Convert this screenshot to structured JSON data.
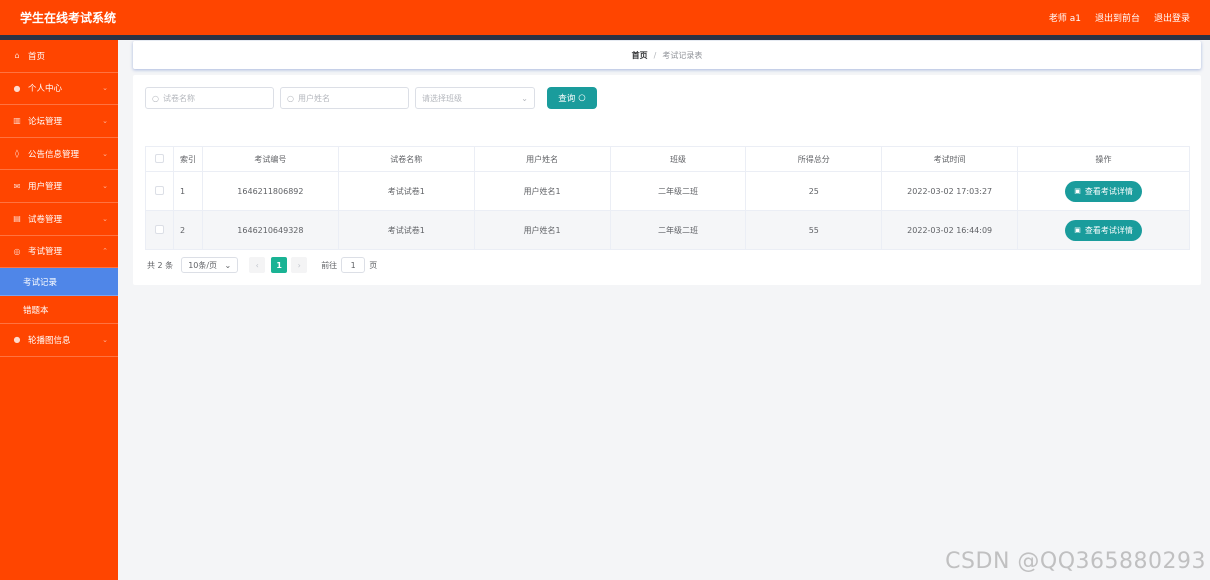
{
  "header": {
    "title": "学生在线考试系统",
    "user": "老师 a1",
    "to_front": "退出到前台",
    "logout": "退出登录"
  },
  "sidebar": {
    "items": [
      {
        "label": "首页",
        "icon": "home-icon",
        "has_children": false
      },
      {
        "label": "个人中心",
        "icon": "user-icon",
        "has_children": true
      },
      {
        "label": "论坛管理",
        "icon": "forum-icon",
        "has_children": true
      },
      {
        "label": "公告信息管理",
        "icon": "notice-icon",
        "has_children": true
      },
      {
        "label": "用户管理",
        "icon": "mail-icon",
        "has_children": true
      },
      {
        "label": "试卷管理",
        "icon": "paper-icon",
        "has_children": true
      },
      {
        "label": "考试管理",
        "icon": "exam-icon",
        "has_children": true,
        "expanded": true,
        "children": [
          {
            "label": "考试记录",
            "active": true
          },
          {
            "label": "错题本",
            "active": false
          }
        ]
      },
      {
        "label": "轮播图信息",
        "icon": "location-icon",
        "has_children": true
      }
    ]
  },
  "breadcrumb": {
    "home": "首页",
    "separator": "/",
    "current": "考试记录表"
  },
  "search": {
    "paper_name_placeholder": "试卷名称",
    "user_name_placeholder": "用户姓名",
    "class_placeholder": "请选择班级",
    "button": "查询"
  },
  "table": {
    "columns": [
      "索引",
      "考试编号",
      "试卷名称",
      "用户姓名",
      "班级",
      "所得总分",
      "考试时间",
      "操作"
    ],
    "rows": [
      {
        "index": "1",
        "exam_no": "1646211806892",
        "paper": "考试试卷1",
        "user": "用户姓名1",
        "class": "二年级二班",
        "score": "25",
        "time": "2022-03-02 17:03:27",
        "action": "查看考试详情"
      },
      {
        "index": "2",
        "exam_no": "1646210649328",
        "paper": "考试试卷1",
        "user": "用户姓名1",
        "class": "二年级二班",
        "score": "55",
        "time": "2022-03-02 16:44:09",
        "action": "查看考试详情"
      }
    ]
  },
  "pagination": {
    "total": "共 2 条",
    "page_size": "10条/页",
    "current_page": "1",
    "goto_label": "前往",
    "goto_value": "1",
    "page_suffix": "页"
  },
  "watermark": "CSDN @QQ365880293",
  "colors": {
    "primary": "#ff4500",
    "dark_bar": "#2c3344",
    "active_menu": "#4f86e8",
    "teal": "#1a9c9c",
    "pager_active": "#1ab394"
  }
}
